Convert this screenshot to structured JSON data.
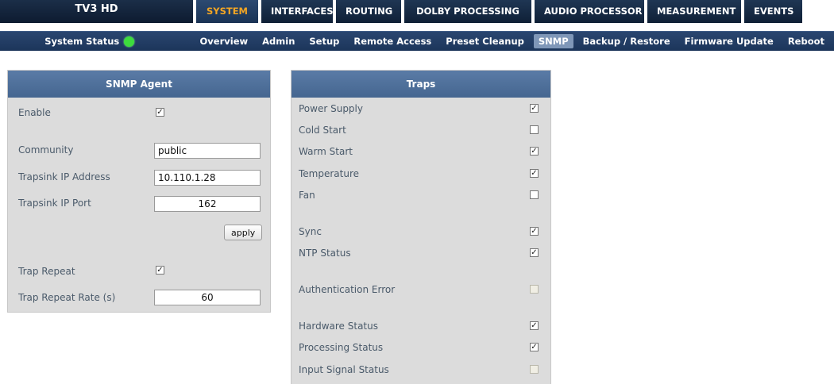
{
  "app": {
    "title": "TV3 HD"
  },
  "main_tabs": [
    {
      "label": "SYSTEM",
      "active": true
    },
    {
      "label": "INTERFACES",
      "active": false
    },
    {
      "label": "ROUTING",
      "active": false
    },
    {
      "label": "DOLBY PROCESSING",
      "active": false
    },
    {
      "label": "AUDIO PROCESSOR",
      "active": false
    },
    {
      "label": "MEASUREMENT",
      "active": false
    },
    {
      "label": "EVENTS",
      "active": false
    }
  ],
  "status": {
    "label": "System Status",
    "color": "#3ddc3d"
  },
  "sub_tabs": [
    {
      "label": "Overview",
      "active": false
    },
    {
      "label": "Admin",
      "active": false
    },
    {
      "label": "Setup",
      "active": false
    },
    {
      "label": "Remote Access",
      "active": false
    },
    {
      "label": "Preset Cleanup",
      "active": false
    },
    {
      "label": "SNMP",
      "active": true
    },
    {
      "label": "Backup / Restore",
      "active": false
    },
    {
      "label": "Firmware Update",
      "active": false
    },
    {
      "label": "Reboot",
      "active": false
    }
  ],
  "snmp_agent": {
    "title": "SNMP Agent",
    "enable_label": "Enable",
    "enable_checked": true,
    "community_label": "Community",
    "community_value": "public",
    "trapsink_ip_label": "Trapsink IP Address",
    "trapsink_ip_value": "10.110.1.28",
    "trapsink_port_label": "Trapsink IP Port",
    "trapsink_port_value": "162",
    "apply_label": "apply",
    "trap_repeat_label": "Trap Repeat",
    "trap_repeat_checked": true,
    "trap_repeat_rate_label": "Trap Repeat Rate (s)",
    "trap_repeat_rate_value": "60"
  },
  "traps": {
    "title": "Traps",
    "items": [
      {
        "label": "Power Supply",
        "checked": true,
        "disabled": false
      },
      {
        "label": "Cold Start",
        "checked": false,
        "disabled": false
      },
      {
        "label": "Warm Start",
        "checked": true,
        "disabled": false
      },
      {
        "label": "Temperature",
        "checked": true,
        "disabled": false
      },
      {
        "label": "Fan",
        "checked": false,
        "disabled": false
      },
      {
        "label": "Sync",
        "checked": true,
        "disabled": false
      },
      {
        "label": "NTP Status",
        "checked": true,
        "disabled": false
      },
      {
        "label": "Authentication Error",
        "checked": false,
        "disabled": true
      },
      {
        "label": "Hardware Status",
        "checked": true,
        "disabled": false
      },
      {
        "label": "Processing Status",
        "checked": true,
        "disabled": false
      },
      {
        "label": "Input Signal Status",
        "checked": false,
        "disabled": true
      }
    ]
  }
}
